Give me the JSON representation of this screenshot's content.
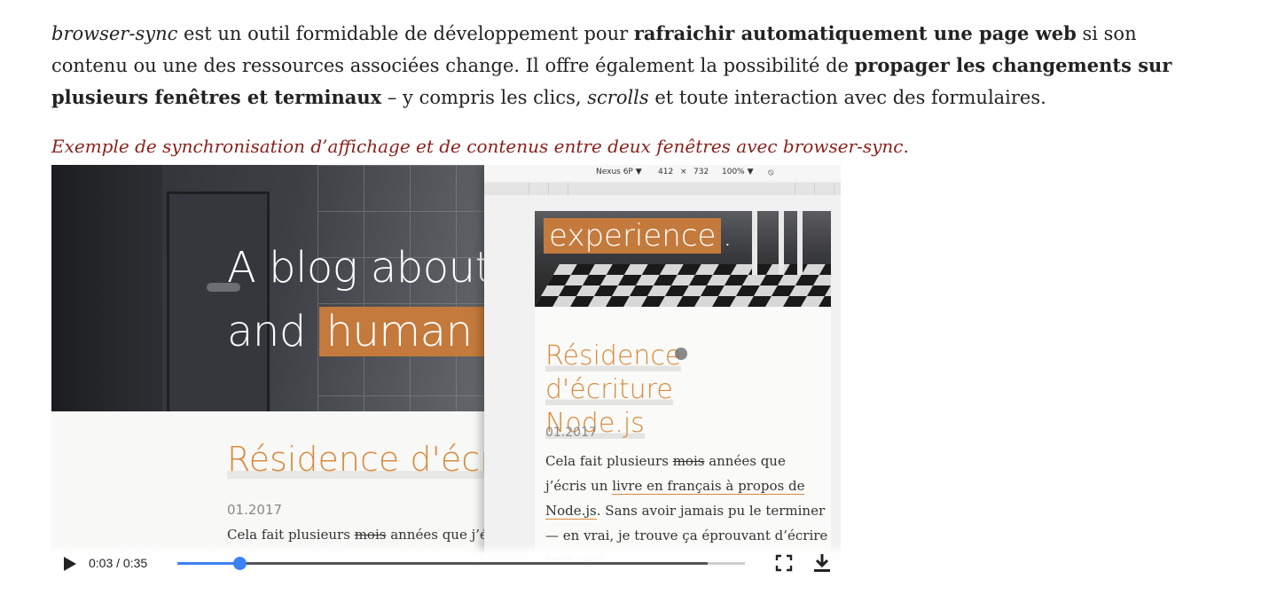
{
  "article": {
    "intro": {
      "p1": "browser-sync",
      "p2": " est un outil formidable de développement pour ",
      "p3": "rafraichir automatiquement une page web",
      "p4": " si son contenu ou une des ressources associées change. Il offre également la possibilité de ",
      "p5": "propager les changements sur plusieurs fenêtres et terminaux",
      "p6": " – y compris les clics, ",
      "p7": "scrolls",
      "p8": " et toute interaction avec des formulaires."
    },
    "caption": "Exemple de synchronisation d’affichage et de contenus entre deux fenêtres avec browser-sync."
  },
  "video": {
    "desktop": {
      "headline_line1": "A blog about",
      "headline_line2_a": "and",
      "headline_line2_b": "human ex",
      "post_title": "Résidence d'écritu",
      "date": "01.2017",
      "text_a": "Cela fait plusieurs ",
      "text_strike": "mois",
      "text_b": " années que j’écri"
    },
    "device": {
      "toolbar": {
        "device_name": "Nexus 6P ▼",
        "width": "412",
        "times": "×",
        "height": "732",
        "zoom": "100% ▼",
        "rotate_icon": "rotate-icon"
      },
      "hero_word": "experience",
      "hero_dot": ".",
      "post_title_line1": "Résidence d'écriture",
      "post_title_line2": "Node.js",
      "date": "01.2017",
      "text_a": "Cela fait plusieurs ",
      "text_strike": "mois",
      "text_b": " années que j’écris un ",
      "text_link": "livre en français à propos de Node.js",
      "text_c": ". Sans avoir jamais pu le terminer — en vrai, je trouve ça éprouvant d’écrire tout seul"
    },
    "controls": {
      "time": "0:03 / 0:35",
      "progress": 0.109,
      "buffered": 0.935,
      "accent_color": "#3b82f6",
      "play_icon": "play-icon",
      "fullscreen_icon": "fullscreen-icon",
      "download_icon": "download-icon"
    }
  }
}
